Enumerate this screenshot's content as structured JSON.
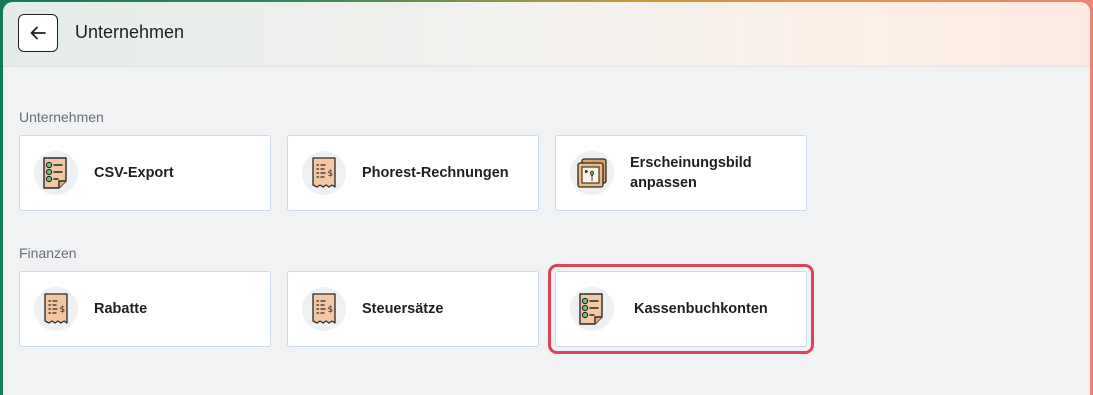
{
  "header": {
    "title": "Unternehmen",
    "back_icon": "arrow-left-icon"
  },
  "sections": [
    {
      "label": "Unternehmen",
      "cards": [
        {
          "label": "CSV-Export",
          "icon": "checklist-document-icon"
        },
        {
          "label": "Phorest-Rechnungen",
          "icon": "receipt-icon"
        },
        {
          "label": "Erscheinungsbild anpassen",
          "icon": "picture-frame-icon"
        }
      ]
    },
    {
      "label": "Finanzen",
      "cards": [
        {
          "label": "Rabatte",
          "icon": "receipt-icon"
        },
        {
          "label": "Steuersätze",
          "icon": "receipt-icon"
        },
        {
          "label": "Kassenbuchkonten",
          "icon": "checklist-document-icon"
        }
      ]
    }
  ],
  "colors": {
    "highlight": "#e0415a",
    "card_border": "#cad9ee",
    "icon_paper": "#f4c7a3",
    "icon_bullet": "#6cc27a"
  }
}
